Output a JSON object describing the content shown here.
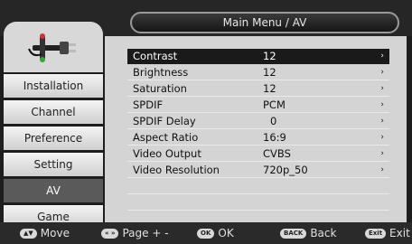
{
  "header": {
    "title": "Main Menu / AV"
  },
  "logo": {
    "icon": "av-cable-icon"
  },
  "nav": {
    "items": [
      {
        "label": "Installation",
        "active": false
      },
      {
        "label": "Channel",
        "active": false
      },
      {
        "label": "Preference",
        "active": false
      },
      {
        "label": "Setting",
        "active": false
      },
      {
        "label": "AV",
        "active": true
      },
      {
        "label": "Game",
        "active": false
      }
    ]
  },
  "settings": {
    "rows": [
      {
        "label": "Contrast",
        "value": "12",
        "arrow": "›",
        "selected": true
      },
      {
        "label": "Brightness",
        "value": "12",
        "arrow": "›"
      },
      {
        "label": "Saturation",
        "value": "12",
        "arrow": "›"
      },
      {
        "label": "SPDIF",
        "value": "PCM",
        "arrow": "›"
      },
      {
        "label": "SPDIF Delay",
        "value": "0",
        "arrow": "›"
      },
      {
        "label": "Aspect Ratio",
        "value": "16:9",
        "arrow": "›"
      },
      {
        "label": "Video Output",
        "value": "CVBS",
        "arrow": "›"
      },
      {
        "label": "Video Resolution",
        "value": "720p_50",
        "arrow": "›"
      }
    ]
  },
  "footer": {
    "move": {
      "key": "▲▼",
      "label": "Move"
    },
    "page": {
      "key": "«  »",
      "label": "Page + -"
    },
    "ok": {
      "key": "OK",
      "label": "OK"
    },
    "back": {
      "key": "BACK",
      "label": "Back"
    },
    "exit": {
      "key": "Exit",
      "label": "Exit"
    }
  }
}
